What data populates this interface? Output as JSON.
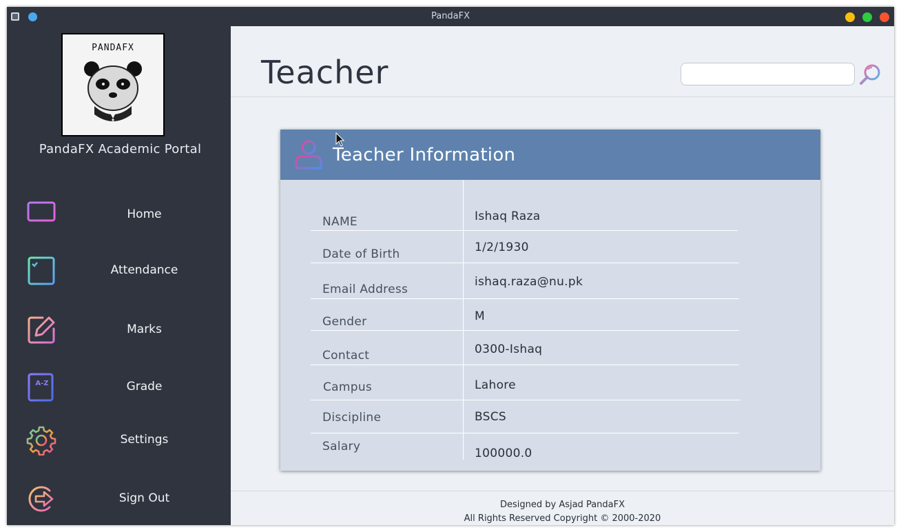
{
  "window": {
    "title": "PandaFX"
  },
  "sidebar": {
    "logo_text": "PANDAFX",
    "portal_title": "PandaFX Academic Portal",
    "items": [
      {
        "label": "Home",
        "icon": "monitor-icon"
      },
      {
        "label": "Attendance",
        "icon": "checklist-icon"
      },
      {
        "label": "Marks",
        "icon": "edit-pencil-icon"
      },
      {
        "label": "Grade",
        "icon": "a-z-book-icon"
      },
      {
        "label": "Settings",
        "icon": "gear-icon"
      },
      {
        "label": "Sign Out",
        "icon": "sign-out-icon"
      }
    ]
  },
  "header": {
    "title": "Teacher",
    "search": {
      "value": "",
      "placeholder": ""
    }
  },
  "card": {
    "title": "Teacher Information",
    "rows": [
      {
        "label": "NAME",
        "value": "Ishaq Raza"
      },
      {
        "label": "Date of Birth",
        "value": "1/2/1930"
      },
      {
        "label": "Email Address",
        "value": "ishaq.raza@nu.pk"
      },
      {
        "label": "Gender",
        "value": "M"
      },
      {
        "label": "Contact",
        "value": "0300-Ishaq"
      },
      {
        "label": "Campus",
        "value": "Lahore"
      },
      {
        "label": "Discipline",
        "value": "BSCS"
      },
      {
        "label": "Salary",
        "value": "100000.0"
      }
    ]
  },
  "footer": {
    "line1": "Designed by Asjad PandaFX",
    "line2": "All Rights Reserved Copyright © 2000-2020"
  },
  "colors": {
    "sidebar_bg": "#2f343f",
    "main_bg": "#edf1f5",
    "card_header": "#5e82ad",
    "card_body": "#d7dde8",
    "accent_pink": "#e8459a",
    "accent_blue": "#4e8ff0"
  }
}
